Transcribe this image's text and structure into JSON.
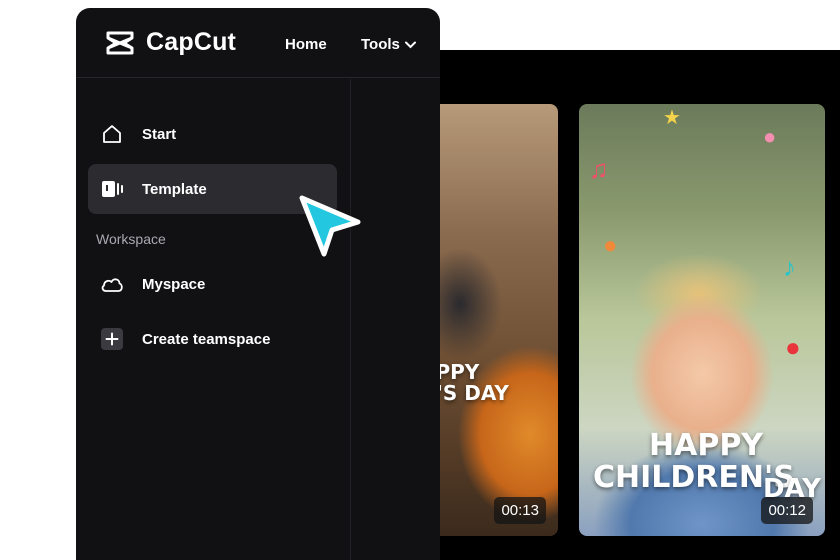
{
  "header": {
    "app_name": "CapCut",
    "nav": {
      "home": "Home",
      "tools": "Tools"
    }
  },
  "sidebar": {
    "items": [
      {
        "label": "Start",
        "icon": "home-icon"
      },
      {
        "label": "Template",
        "icon": "template-icon"
      },
      {
        "label": "Myspace",
        "icon": "cloud-icon"
      },
      {
        "label": "Create teamspace",
        "icon": "plus-icon"
      }
    ],
    "section_label": "Workspace"
  },
  "templates": [
    {
      "title_lines": [
        "APPY",
        "N'S DAY"
      ],
      "duration": "00:13"
    },
    {
      "title_lines": [
        "HAPPY",
        "CHILDREN'S",
        "DAY"
      ],
      "duration": "00:12"
    }
  ],
  "colors": {
    "panel_bg": "#111114",
    "active_item_bg": "#2b2b30",
    "cursor_fill": "#23c8e0",
    "section_text": "#a9a9b0"
  }
}
